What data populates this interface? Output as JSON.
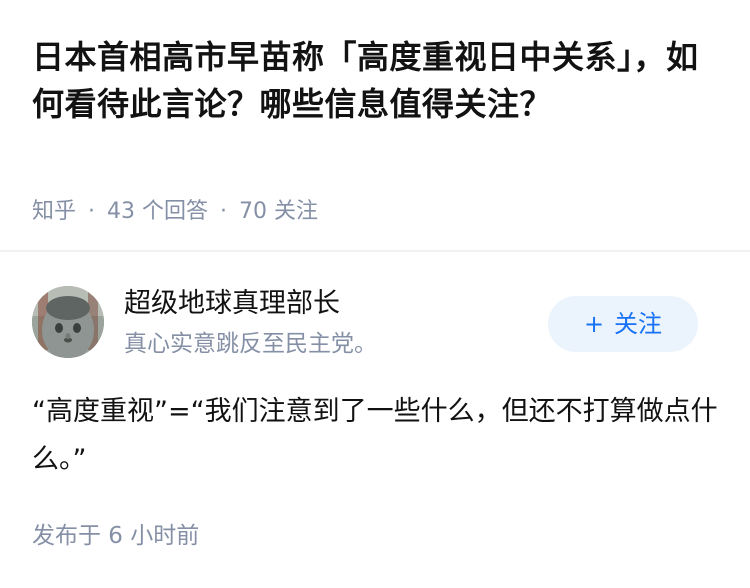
{
  "question": {
    "title": "日本首相高市早苗称「高度重视日中关系」，如何看待此言论？哪些信息值得关注？",
    "source": "知乎",
    "answer_count": "43 个回答",
    "follower_count": "70 关注"
  },
  "answer": {
    "author_name": "超级地球真理部长",
    "author_bio": "真心实意跳反至民主党。",
    "follow_label": "关注",
    "follow_icon": "plus-icon",
    "content": "“高度重视”=“我们注意到了一些什么，但还不打算做点什么。”",
    "publish_time": "发布于 6 小时前"
  },
  "colors": {
    "title_text": "#121212",
    "meta_text": "#8590a6",
    "follow_button_bg": "#ebf3fc",
    "follow_button_text": "#1772f6",
    "divider": "#f2f2f2"
  }
}
